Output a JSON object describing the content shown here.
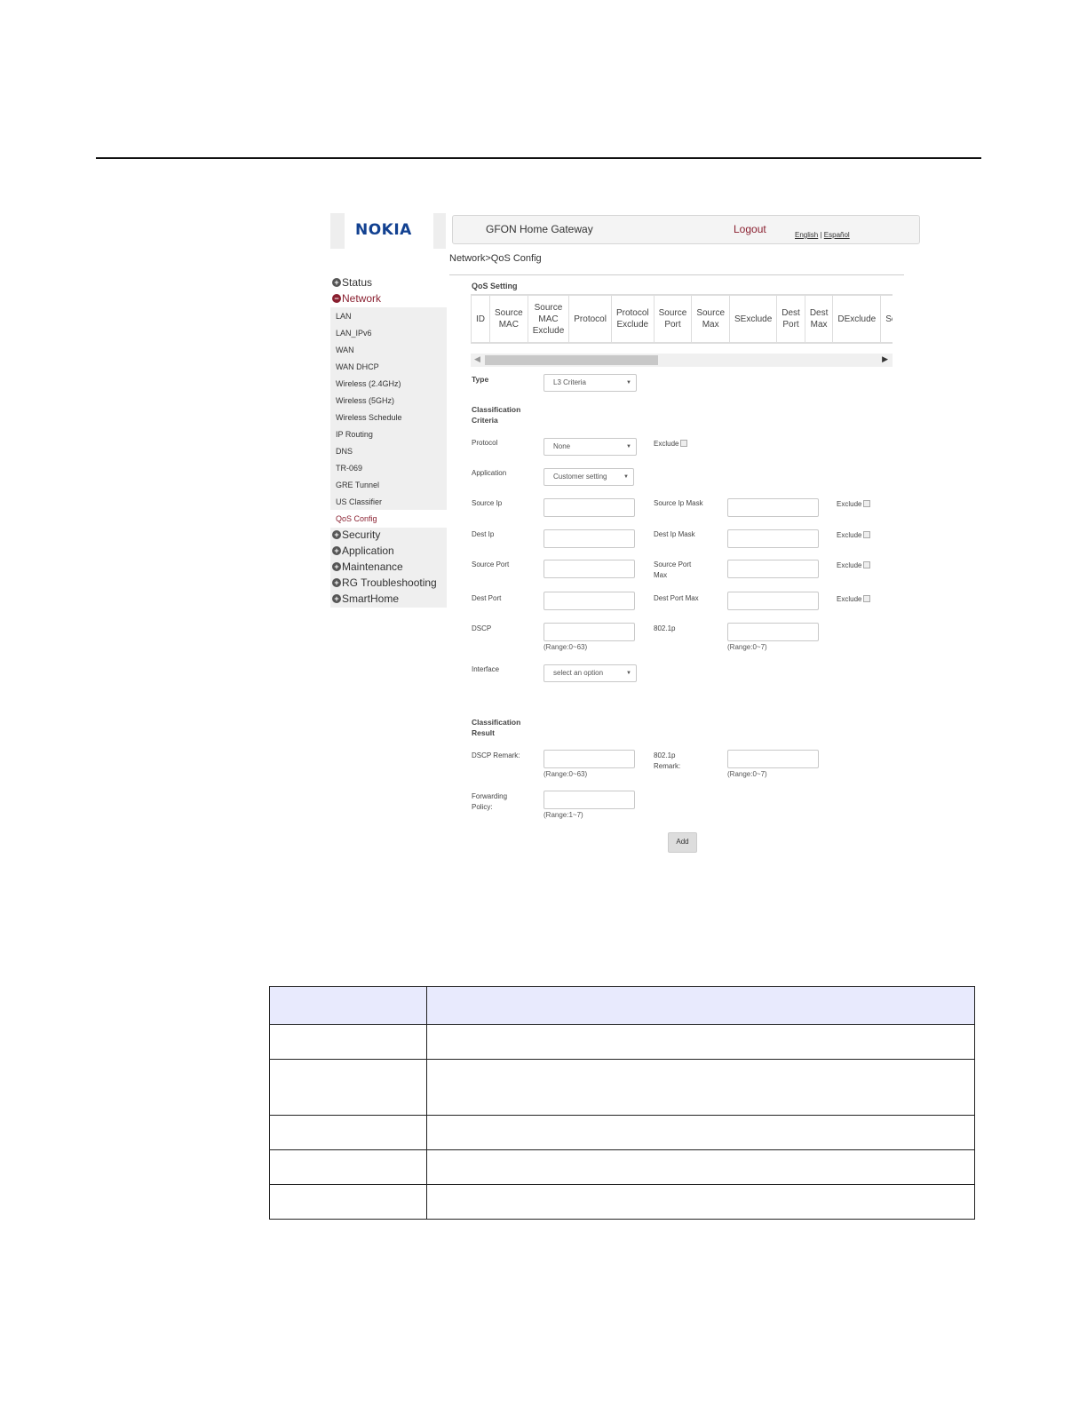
{
  "header": {
    "logo": "NOKIA",
    "app_title": "GFON Home Gateway",
    "logout": "Logout",
    "lang_english": "English",
    "lang_sep": " | ",
    "lang_espanol": "Español"
  },
  "breadcrumb": "Network>QoS Config",
  "sidebar": {
    "top": [
      {
        "label": "Status",
        "icon": "plus-icon"
      },
      {
        "label": "Network",
        "icon": "minus-icon"
      },
      {
        "label": "Security",
        "icon": "plus-icon"
      },
      {
        "label": "Application",
        "icon": "plus-icon"
      },
      {
        "label": "Maintenance",
        "icon": "plus-icon"
      },
      {
        "label": "RG Troubleshooting",
        "icon": "plus-icon"
      },
      {
        "label": "SmartHome",
        "icon": "plus-icon"
      }
    ],
    "network_items": [
      "LAN",
      "LAN_IPv6",
      "WAN",
      "WAN DHCP",
      "Wireless (2.4GHz)",
      "Wireless (5GHz)",
      "Wireless Schedule",
      "IP Routing",
      "DNS",
      "TR-069",
      "GRE Tunnel",
      "US Classifier",
      "QoS Config"
    ]
  },
  "qos": {
    "section_label": "QoS Setting",
    "columns": [
      [
        "ID"
      ],
      [
        "Source",
        "MAC"
      ],
      [
        "Source",
        "MAC",
        "Exclude"
      ],
      [
        "Protocol"
      ],
      [
        "Protocol",
        "Exclude"
      ],
      [
        "Source",
        "Port"
      ],
      [
        "Source",
        "Max"
      ],
      [
        "SExclude"
      ],
      [
        "Dest",
        "Port"
      ],
      [
        "Dest",
        "Max"
      ],
      [
        "DExclude"
      ],
      [
        "Sc"
      ]
    ]
  },
  "form": {
    "type_label": "Type",
    "type_value": "L3 Criteria",
    "criteria_label_1": "Classification",
    "criteria_label_2": "Criteria",
    "protocol_label": "Protocol",
    "protocol_value": "None",
    "exclude_label": "Exclude",
    "application_label": "Application",
    "application_value": "Customer setting",
    "source_ip_label": "Source Ip",
    "source_ip_mask_label": "Source Ip Mask",
    "dest_ip_label": "Dest Ip",
    "dest_ip_mask_label": "Dest Ip Mask",
    "source_port_label": "Source Port",
    "source_port_max_label_1": "Source Port",
    "source_port_max_label_2": "Max",
    "dest_port_label": "Dest Port",
    "dest_port_max_label": "Dest Port Max",
    "dscp_label": "DSCP",
    "dscp_range": "(Range:0~63)",
    "p8021_label": "802.1p",
    "p8021_range": "(Range:0~7)",
    "interface_label": "Interface",
    "interface_value": "select an option",
    "result_label_1": "Classification",
    "result_label_2": "Result",
    "dscp_remark_label": "DSCP Remark:",
    "dscp_remark_range": "(Range:0~63)",
    "p8021_remark_label_1": "802.1p",
    "p8021_remark_label_2": "Remark:",
    "p8021_remark_range": "(Range:0~7)",
    "forwarding_label_1": "Forwarding",
    "forwarding_label_2": "Policy:",
    "forwarding_range": "(Range:1~7)",
    "add_button": "Add"
  }
}
